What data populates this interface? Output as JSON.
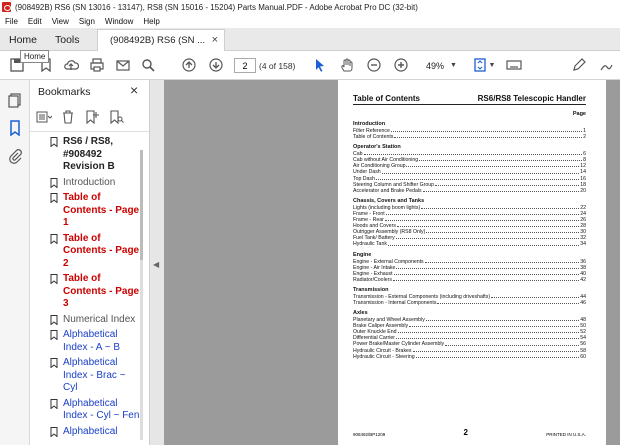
{
  "window": {
    "title": "(908492B) RS6 (SN 13016 - 13147), RS8 (SN 15016 - 15204) Parts Manual.PDF - Adobe Acrobat Pro DC (32-bit)"
  },
  "menu": [
    "File",
    "Edit",
    "View",
    "Sign",
    "Window",
    "Help"
  ],
  "tabs": {
    "home": "Home",
    "tools": "Tools",
    "doc": "(908492B) RS6 (SN ..."
  },
  "tooltip": "Home",
  "toolbar": {
    "page_value": "2",
    "page_count": "(4 of 158)",
    "zoom": "49%"
  },
  "bookmarks": {
    "title": "Bookmarks",
    "items": [
      {
        "label": "RS6 / RS8, #908492 Revision B",
        "style": "dark"
      },
      {
        "label": "Introduction",
        "style": "gray"
      },
      {
        "label": "Table of Contents - Page 1",
        "style": "red"
      },
      {
        "label": "Table of Contents - Page 2",
        "style": "red"
      },
      {
        "label": "Table of Contents - Page 3",
        "style": "red"
      },
      {
        "label": "Numerical Index",
        "style": "gray"
      },
      {
        "label": "Alphabetical Index - A ~ B",
        "style": "blue"
      },
      {
        "label": "Alphabetical Index - Brac ~ Cyl",
        "style": "blue"
      },
      {
        "label": "Alphabetical Index - Cyl ~ Fen",
        "style": "blue"
      },
      {
        "label": "Alphabetical",
        "style": "blue"
      }
    ]
  },
  "document": {
    "header_left": "Table of Contents",
    "header_right": "RS6/RS8 Telescopic Handler",
    "page_label": "Page",
    "sections": [
      {
        "title": "Introduction",
        "rows": [
          {
            "t": "Filter Reference",
            "p": "1"
          },
          {
            "t": "Table of Contents",
            "p": "2"
          }
        ]
      },
      {
        "title": "Operator's Station",
        "rows": [
          {
            "t": "Cab",
            "p": "6"
          },
          {
            "t": "Cab without Air Conditioning",
            "p": "8"
          },
          {
            "t": "Air Conditioning Group",
            "p": "12"
          },
          {
            "t": "Under Dash",
            "p": "14"
          },
          {
            "t": "Top Dash",
            "p": "16"
          },
          {
            "t": "Steering Column and Shifter Group",
            "p": "18"
          },
          {
            "t": "Accelerator and Brake Pedals",
            "p": "20"
          }
        ]
      },
      {
        "title": "Chassis, Covers and Tanks",
        "rows": [
          {
            "t": "Lights (including boom lights)",
            "p": "22"
          },
          {
            "t": "Frame - Front",
            "p": "24"
          },
          {
            "t": "Frame - Rear",
            "p": "26"
          },
          {
            "t": "Hoods and Covers",
            "p": "28"
          },
          {
            "t": "Outrigger Assembly (RS8 Only)",
            "p": "30"
          },
          {
            "t": "Fuel Tank/ Battery",
            "p": "32"
          },
          {
            "t": "Hydraulic Tank",
            "p": "34"
          }
        ]
      },
      {
        "title": "Engine",
        "rows": [
          {
            "t": "Engine - External Components",
            "p": "36"
          },
          {
            "t": "Engine - Air Intake",
            "p": "38"
          },
          {
            "t": "Engine - Exhaust",
            "p": "40"
          },
          {
            "t": "Radiator/Coolers",
            "p": "42"
          }
        ]
      },
      {
        "title": "Transmission",
        "rows": [
          {
            "t": "Transmission - External Components (including driveshafts)",
            "p": "44"
          },
          {
            "t": "Transmission - Internal Components",
            "p": "46"
          }
        ]
      },
      {
        "title": "Axles",
        "rows": [
          {
            "t": "Planetary and Wheel Assembly",
            "p": "48"
          },
          {
            "t": "Brake Caliper Assembly",
            "p": "50"
          },
          {
            "t": "Outer Knuckle End",
            "p": "52"
          },
          {
            "t": "Differential Carrier",
            "p": "54"
          },
          {
            "t": "Power Brake/Master Cylinder Assembly",
            "p": "56"
          },
          {
            "t": "Hydraulic Circuit - Brakes",
            "p": "58"
          },
          {
            "t": "Hydraulic Circuit - Steering",
            "p": "60"
          }
        ]
      }
    ],
    "footer_left": "908492/BP1209",
    "footer_center": "2",
    "footer_right": "PRINTED IN U.S.A."
  }
}
